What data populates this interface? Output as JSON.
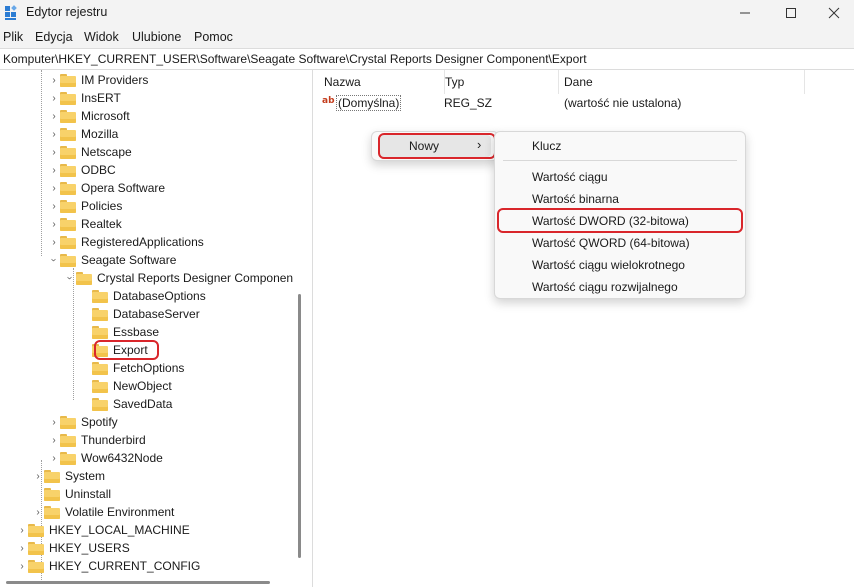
{
  "window": {
    "title": "Edytor rejestru",
    "icons": {
      "app": "registry-icon",
      "minimize": "minimize-icon",
      "maximize": "maximize-icon",
      "close": "close-icon"
    }
  },
  "menu": [
    "Plik",
    "Edycja",
    "Widok",
    "Ulubione",
    "Pomoc"
  ],
  "address": "Komputer\\HKEY_CURRENT_USER\\Software\\Seagate Software\\Crystal Reports Designer Component\\Export",
  "tree": {
    "items": [
      {
        "label": "IM Providers"
      },
      {
        "label": "InsERT"
      },
      {
        "label": "Microsoft"
      },
      {
        "label": "Mozilla"
      },
      {
        "label": "Netscape"
      },
      {
        "label": "ODBC"
      },
      {
        "label": "Opera Software"
      },
      {
        "label": "Policies"
      },
      {
        "label": "Realtek"
      },
      {
        "label": "RegisteredApplications"
      },
      {
        "label": "Seagate Software"
      },
      {
        "label": "Crystal Reports Designer Componen"
      },
      {
        "label": "DatabaseOptions"
      },
      {
        "label": "DatabaseServer"
      },
      {
        "label": "Essbase"
      },
      {
        "label": "Export"
      },
      {
        "label": "FetchOptions"
      },
      {
        "label": "NewObject"
      },
      {
        "label": "SavedData"
      },
      {
        "label": "Spotify"
      },
      {
        "label": "Thunderbird"
      },
      {
        "label": "Wow6432Node"
      },
      {
        "label": "System"
      },
      {
        "label": "Uninstall"
      },
      {
        "label": "Volatile Environment"
      },
      {
        "label": "HKEY_LOCAL_MACHINE"
      },
      {
        "label": "HKEY_USERS"
      },
      {
        "label": "HKEY_CURRENT_CONFIG"
      }
    ],
    "selected": "Export"
  },
  "list": {
    "columns": [
      "Nazwa",
      "Typ",
      "Dane"
    ],
    "rows": [
      {
        "name": "(Domyślna)",
        "type": "REG_SZ",
        "data": "(wartość nie ustalona)"
      }
    ]
  },
  "context_menu": {
    "new_label": "Nowy",
    "submenu": [
      "Klucz",
      "Wartość ciągu",
      "Wartość binarna",
      "Wartość DWORD (32-bitowa)",
      "Wartość QWORD (64-bitowa)",
      "Wartość ciągu wielokrotnego",
      "Wartość ciągu rozwijalnego"
    ]
  },
  "colors": {
    "highlight": "#d9262b",
    "folder": "#f8d26a",
    "accent": "#0067c0"
  }
}
